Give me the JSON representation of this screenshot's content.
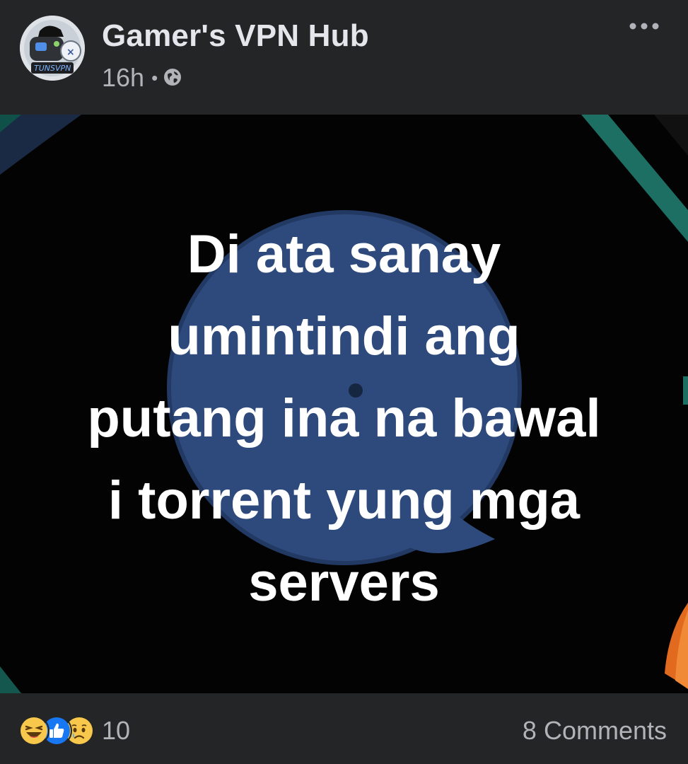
{
  "post": {
    "page_name": "Gamer's VPN Hub",
    "time_ago": "16h",
    "separator": "•",
    "audience_icon": "globe-icon",
    "avatar_text": "TUNSVPN",
    "more_icon": "more-horizontal-icon",
    "image_text": {
      "lines": [
        "Di ata sanay",
        "umintindi ang",
        "putang ina na bawal",
        "i torrent yung mga",
        "servers"
      ]
    },
    "reactions": {
      "icons": [
        "haha-icon",
        "like-icon",
        "sad-icon"
      ],
      "count": "10"
    },
    "comments_label": "8 Comments"
  },
  "colors": {
    "background": "#242526",
    "text_primary": "#e4e6eb",
    "text_secondary": "#b0b3b8",
    "like_blue": "#1877f2",
    "emoji_yellow": "#f7c84b"
  }
}
